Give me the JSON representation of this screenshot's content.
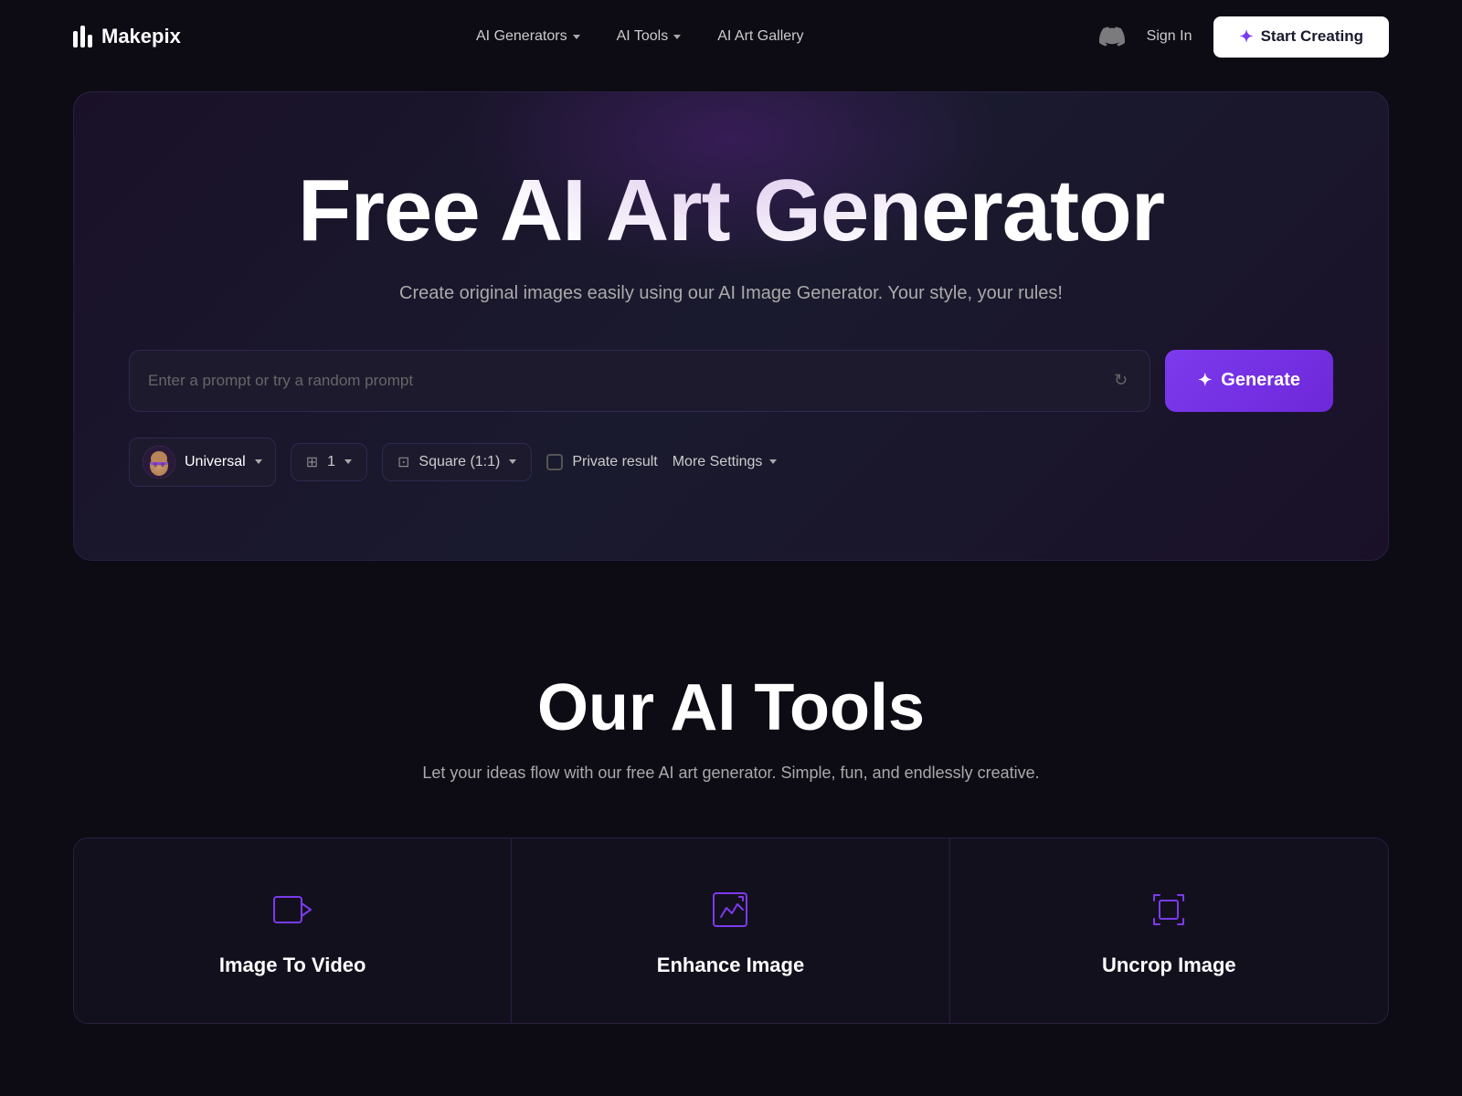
{
  "nav": {
    "logo": "Makepix",
    "links": [
      {
        "label": "AI Generators",
        "hasDropdown": true
      },
      {
        "label": "AI Tools",
        "hasDropdown": true
      },
      {
        "label": "AI Art Gallery",
        "hasDropdown": false
      }
    ],
    "sign_in": "Sign In",
    "start_creating": "Start Creating"
  },
  "hero": {
    "title": "Free AI Art Generator",
    "subtitle": "Create original images easily using our AI Image Generator. Your style, your rules!",
    "prompt_placeholder": "Enter a prompt or try a random prompt",
    "generate_label": "Generate",
    "model_name": "Universal",
    "count": "1",
    "ratio": "Square (1:1)",
    "private_label": "Private result",
    "more_settings": "More Settings"
  },
  "tools_section": {
    "title": "Our AI Tools",
    "subtitle": "Let your ideas flow with our free AI art generator. Simple, fun, and endlessly creative.",
    "tools": [
      {
        "name": "Image To Video",
        "icon": "video"
      },
      {
        "name": "Enhance Image",
        "icon": "enhance"
      },
      {
        "name": "Uncrop Image",
        "icon": "uncrop"
      }
    ]
  }
}
